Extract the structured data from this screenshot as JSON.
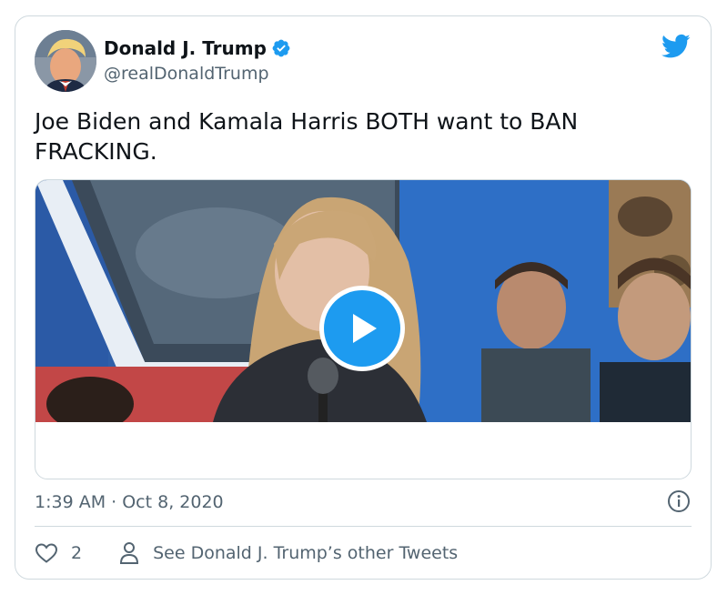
{
  "author": {
    "display_name": "Donald J. Trump",
    "handle": "@realDonaldTrump",
    "verified": true,
    "avatar_icon": "profile-photo"
  },
  "tweet": {
    "text": "Joe Biden and Kamala Harris BOTH want to BAN FRACKING.",
    "timestamp": "1:39 AM · Oct 8, 2020"
  },
  "media": {
    "type": "video",
    "play_icon": "play-icon"
  },
  "actions": {
    "like_icon": "heart-icon",
    "like_count": "2",
    "profile_icon": "person-icon",
    "other_tweets_label": "See Donald J. Trump’s other Tweets"
  },
  "icons": {
    "brand": "twitter-bird-icon",
    "info": "info-icon",
    "verified": "verified-badge-icon"
  },
  "colors": {
    "accent": "#1d9bf0",
    "text_primary": "#0f1419",
    "text_secondary": "#536471",
    "border": "#cfd9de"
  }
}
